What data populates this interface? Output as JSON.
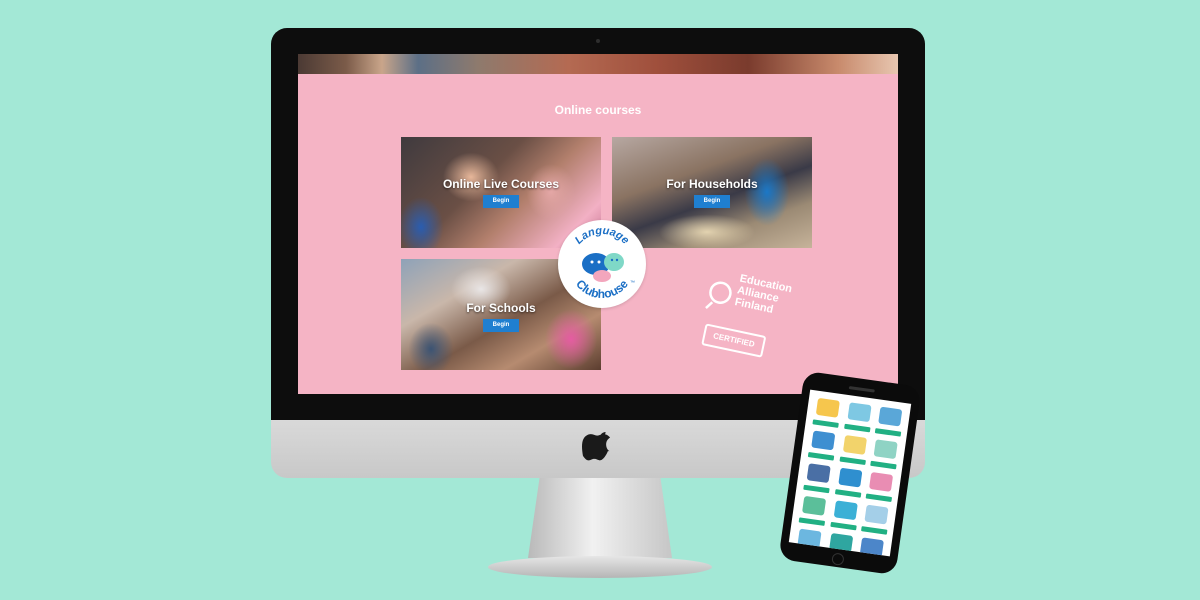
{
  "page": {
    "section_title": "Online courses"
  },
  "cards": [
    {
      "title": "Online Live Courses",
      "button": "Begin"
    },
    {
      "title": "For Households",
      "button": "Begin"
    },
    {
      "title": "For Schools",
      "button": "Begin"
    }
  ],
  "logo": {
    "line1": "Language",
    "line2": "Clubhouse",
    "tm": "™"
  },
  "badge": {
    "line1": "Education",
    "line2": "Alliance",
    "line3": "Finland",
    "certified": "CERTIFIED"
  },
  "colors": {
    "background": "#a3e8d6",
    "screen_pink": "#f5b4c5",
    "button_blue": "#1f7fd0",
    "logo_blue": "#1b6fc5",
    "phone_tile_green": "#21b083"
  },
  "icons": {
    "apple_logo": "apple-icon"
  }
}
